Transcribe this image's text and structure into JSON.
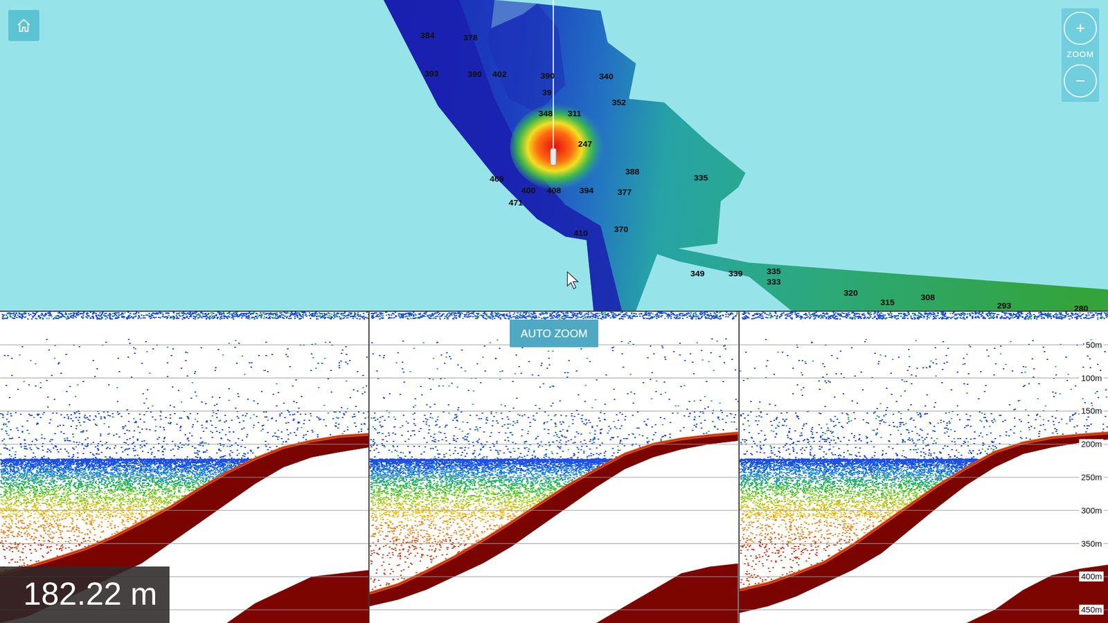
{
  "map": {
    "home_button": {
      "label": ""
    },
    "zoom": {
      "in": "+",
      "label": "ZOOM",
      "out": "−"
    },
    "depth_labels": [
      "384",
      "378",
      "393",
      "390",
      "402",
      "390",
      "39",
      "340",
      "348",
      "311",
      "352",
      "247",
      "388",
      "335",
      "469",
      "400",
      "408",
      "394",
      "377",
      "471",
      "410",
      "370",
      "349",
      "339",
      "335",
      "333",
      "320",
      "315",
      "308",
      "293",
      "280"
    ]
  },
  "echogram": {
    "auto_zoom": "AUTO ZOOM",
    "readout": "182.22 m",
    "depth_ticks": [
      "50m",
      "100m",
      "150m",
      "200m",
      "250m",
      "300m",
      "350m",
      "400m",
      "450m"
    ],
    "panels": [
      {
        "seabed": [
          395,
          385,
          372,
          358,
          340,
          318,
          295,
          268,
          243,
          222,
          205,
          195,
          188,
          185
        ],
        "sub_bottom": [
          470,
          460,
          440,
          420,
          400,
          380,
          350,
          320,
          290,
          260,
          235,
          220,
          212,
          205
        ],
        "second_echo": [
          470,
          470,
          470,
          470,
          470,
          470,
          470,
          470,
          470,
          440,
          420,
          400,
          395,
          390
        ]
      },
      {
        "seabed": [
          425,
          412,
          392,
          370,
          345,
          318,
          290,
          262,
          238,
          215,
          200,
          192,
          187,
          183
        ],
        "sub_bottom": [
          445,
          435,
          420,
          400,
          380,
          355,
          325,
          295,
          265,
          238,
          220,
          208,
          200,
          195
        ],
        "second_echo": [
          470,
          470,
          470,
          470,
          470,
          470,
          470,
          470,
          470,
          445,
          420,
          395,
          385,
          380
        ]
      },
      {
        "seabed": [
          420,
          410,
          395,
          378,
          352,
          322,
          292,
          262,
          236,
          212,
          198,
          190,
          186,
          183
        ],
        "sub_bottom": [
          455,
          445,
          430,
          410,
          390,
          365,
          330,
          295,
          262,
          235,
          215,
          205,
          198,
          193
        ],
        "second_echo": [
          470,
          470,
          470,
          470,
          470,
          470,
          470,
          470,
          470,
          450,
          420,
          398,
          388,
          382
        ]
      }
    ]
  }
}
